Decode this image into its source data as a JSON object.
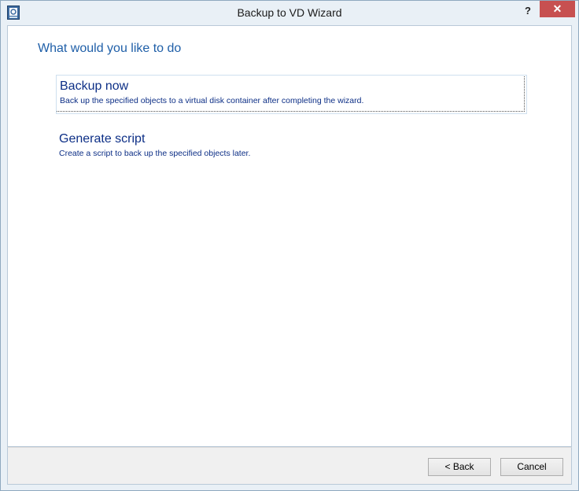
{
  "window": {
    "title": "Backup to VD Wizard",
    "help_label": "?",
    "close_label": "✕"
  },
  "page": {
    "heading": "What would you like to do"
  },
  "options": [
    {
      "title": "Backup now",
      "description": "Back up the specified objects to a virtual disk container after completing the wizard."
    },
    {
      "title": "Generate script",
      "description": "Create a script to back up the specified objects later."
    }
  ],
  "footer": {
    "back_label": "< Back",
    "cancel_label": "Cancel"
  },
  "colors": {
    "accent": "#1f5fa8",
    "option_text": "#0d2f86",
    "close_button": "#c75050"
  },
  "icons": {
    "app": "disk-backup-icon"
  }
}
